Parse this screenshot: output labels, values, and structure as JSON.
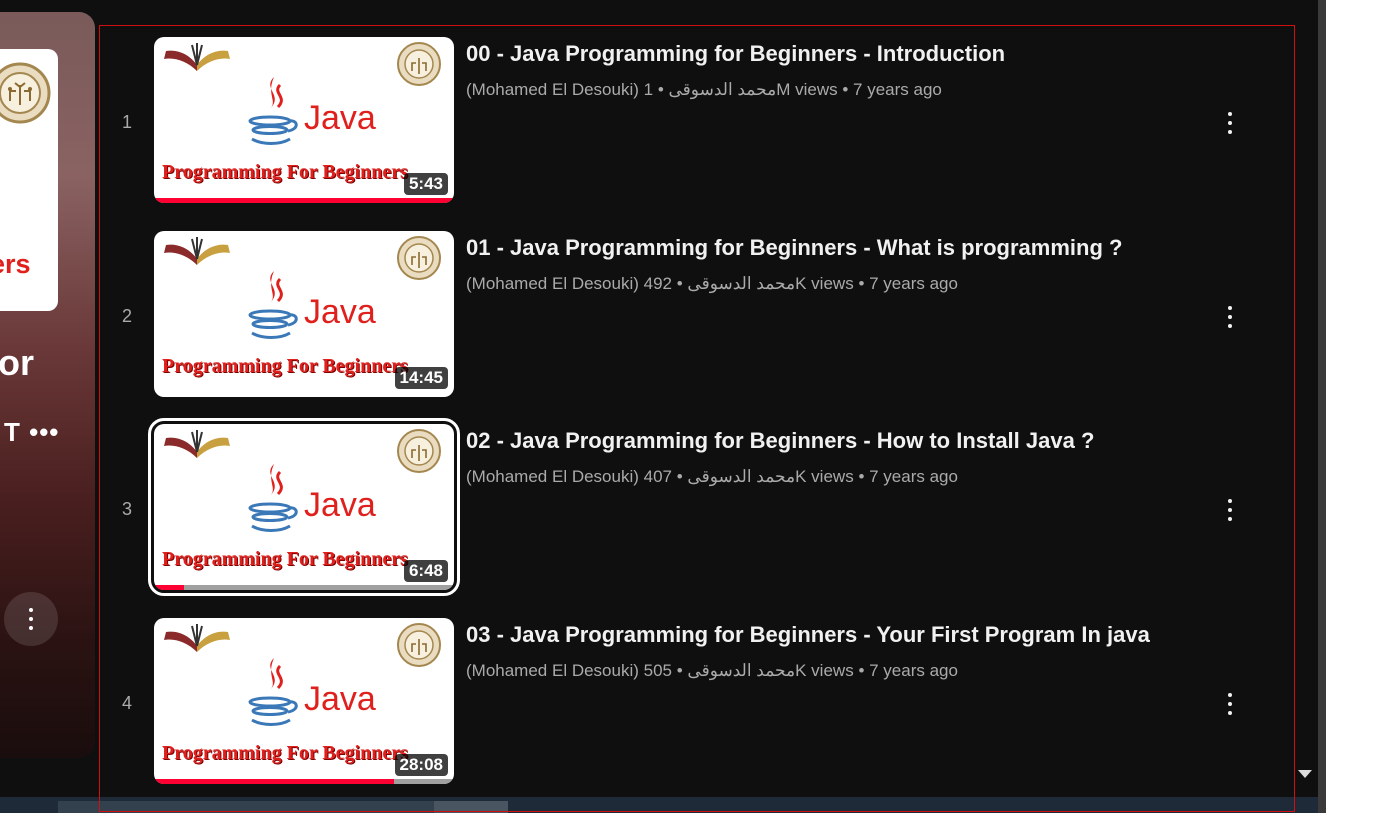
{
  "hero": {
    "thumb_text": "ers",
    "title_fragment": "or",
    "subtitle_fragment": "T •••"
  },
  "videos": [
    {
      "index": "1",
      "title": "00 - Java Programming for Beginners - Introduction",
      "channel": "(Mohamed El Desouki) محمد الدسوقى",
      "views": "1M views",
      "age": "7 years ago",
      "duration": "5:43",
      "watched_fraction": 1.0,
      "selected": false
    },
    {
      "index": "2",
      "title": "01 - Java Programming for Beginners - What is programming ?",
      "channel": "(Mohamed El Desouki) محمد الدسوقى",
      "views": "492K views",
      "age": "7 years ago",
      "duration": "14:45",
      "watched_fraction": 0,
      "selected": false
    },
    {
      "index": "3",
      "title": "02 - Java Programming for Beginners - How to Install Java ?",
      "channel": "(Mohamed El Desouki) محمد الدسوقى",
      "views": "407K views",
      "age": "7 years ago",
      "duration": "6:48",
      "watched_fraction": 0.1,
      "selected": true
    },
    {
      "index": "4",
      "title": "03 - Java Programming for Beginners - Your First Program In java",
      "channel": "(Mohamed El Desouki) محمد الدسوقى",
      "views": "505K views",
      "age": "7 years ago",
      "duration": "28:08",
      "watched_fraction": 0.8,
      "selected": false
    }
  ],
  "thumbnail": {
    "java_word": "Java",
    "banner": "Programming For Beginners"
  },
  "colors": {
    "accent_red": "#ff0033",
    "background": "#0f0f0f",
    "highlight_box": "#d01010"
  },
  "icons": {
    "row_menu": "more-vertical-icon",
    "hero_menu": "more-vertical-icon",
    "scroll_down": "triangle-down-icon"
  }
}
